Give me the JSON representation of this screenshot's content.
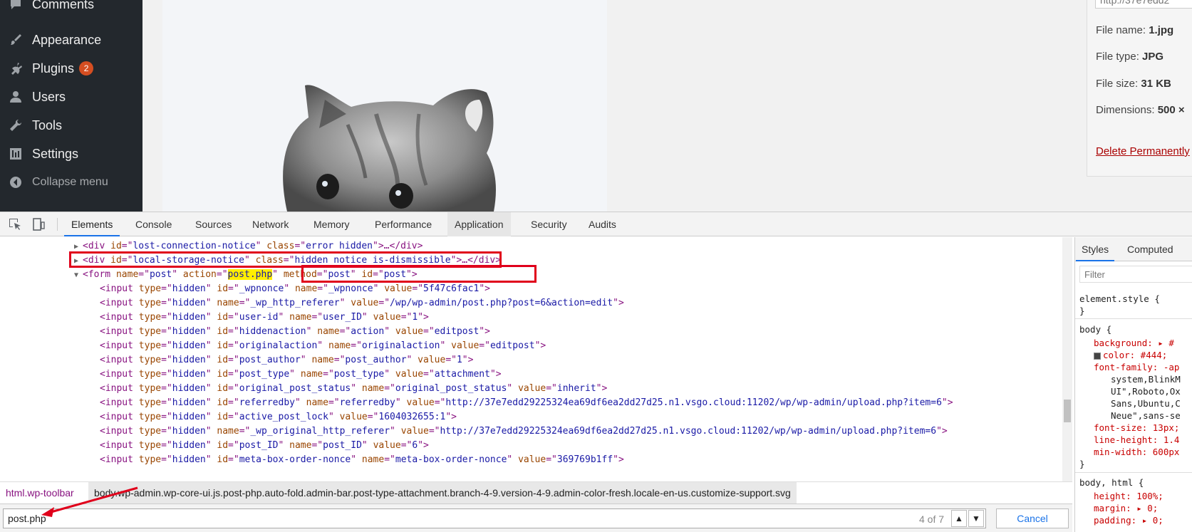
{
  "wp": {
    "menu": [
      {
        "label": "Comments",
        "icon": "comment-icon"
      },
      {
        "label": "Appearance",
        "icon": "paintbrush-icon"
      },
      {
        "label": "Plugins",
        "icon": "plugin-icon",
        "badge": "2"
      },
      {
        "label": "Users",
        "icon": "user-icon"
      },
      {
        "label": "Tools",
        "icon": "wrench-icon"
      },
      {
        "label": "Settings",
        "icon": "settings-icon"
      },
      {
        "label": "Collapse menu",
        "icon": "collapse-icon"
      }
    ],
    "attachment": {
      "url": "http://37e7edd2",
      "file_name_label": "File name:",
      "file_name": "1.jpg",
      "file_type_label": "File type:",
      "file_type": "JPG",
      "file_size_label": "File size:",
      "file_size": "31 KB",
      "dimensions_label": "Dimensions:",
      "dimensions": "500 ×",
      "delete_label": "Delete Permanently"
    }
  },
  "devtools": {
    "tabs": [
      "Elements",
      "Console",
      "Sources",
      "Network",
      "Memory",
      "Performance",
      "Application",
      "Security",
      "Audits"
    ],
    "active_tab": "Elements",
    "breadcrumb": {
      "first": "html.wp-toolbar",
      "selected": "body.wp-admin.wp-core-ui.js.post-php.auto-fold.admin-bar.post-type-attachment.branch-4-9.version-4-9.admin-color-fresh.locale-en-us.customize-support.svg"
    },
    "search": {
      "value": "post.php",
      "match_count": "4 of 7",
      "up": "▲",
      "down": "▼",
      "cancel": "Cancel"
    },
    "styles": {
      "tabs": [
        "Styles",
        "Computed"
      ],
      "filter_placeholder": "Filter",
      "lines": [
        "element.style {",
        "}",
        "body {",
        "background: ▸ #",
        "color: #444;",
        "font-family: -ap",
        "system,BlinkM",
        "UI\",Roboto,Ox",
        "Sans,Ubuntu,C",
        "Neue\",sans-se",
        "font-size: 13px;",
        "line-height: 1.4",
        "min-width: 600px",
        "}",
        "body, html {",
        "height: 100%;",
        "margin: ▸ 0;",
        "padding: ▸ 0;"
      ]
    },
    "code": [
      [
        "<div ",
        "id",
        "=\"",
        "lost-connection-notice",
        "\" ",
        "class",
        "=\"",
        "error hidden",
        "\">…</div>"
      ],
      [
        "<div ",
        "id",
        "=\"",
        "local-storage-notice",
        "\" ",
        "class",
        "=\"",
        "hidden notice is-dismissible",
        "\">…</div>"
      ],
      [
        "<form ",
        "name",
        "=\"",
        "post",
        "\" ",
        "action",
        "=\"",
        "post.php",
        "\" ",
        "method",
        "=\"",
        "post",
        "\" ",
        "id",
        "=\"",
        "post",
        "\">"
      ],
      [
        "<input ",
        "type",
        "=\"",
        "hidden",
        "\" ",
        "id",
        "=\"",
        "_wpnonce",
        "\" ",
        "name",
        "=\"",
        "_wpnonce",
        "\" ",
        "value",
        "=\"",
        "5f47c6fac1",
        "\">"
      ],
      [
        "<input ",
        "type",
        "=\"",
        "hidden",
        "\" ",
        "name",
        "=\"",
        "_wp_http_referer",
        "\" ",
        "value",
        "=\"",
        "/wp/wp-admin/post.php?post=6&action=edit",
        "\">"
      ],
      [
        "<input ",
        "type",
        "=\"",
        "hidden",
        "\" ",
        "id",
        "=\"",
        "user-id",
        "\" ",
        "name",
        "=\"",
        "user_ID",
        "\" ",
        "value",
        "=\"",
        "1",
        "\">"
      ],
      [
        "<input ",
        "type",
        "=\"",
        "hidden",
        "\" ",
        "id",
        "=\"",
        "hiddenaction",
        "\" ",
        "name",
        "=\"",
        "action",
        "\" ",
        "value",
        "=\"",
        "editpost",
        "\">"
      ],
      [
        "<input ",
        "type",
        "=\"",
        "hidden",
        "\" ",
        "id",
        "=\"",
        "originalaction",
        "\" ",
        "name",
        "=\"",
        "originalaction",
        "\" ",
        "value",
        "=\"",
        "editpost",
        "\">"
      ],
      [
        "<input ",
        "type",
        "=\"",
        "hidden",
        "\" ",
        "id",
        "=\"",
        "post_author",
        "\" ",
        "name",
        "=\"",
        "post_author",
        "\" ",
        "value",
        "=\"",
        "1",
        "\">"
      ],
      [
        "<input ",
        "type",
        "=\"",
        "hidden",
        "\" ",
        "id",
        "=\"",
        "post_type",
        "\" ",
        "name",
        "=\"",
        "post_type",
        "\" ",
        "value",
        "=\"",
        "attachment",
        "\">"
      ],
      [
        "<input ",
        "type",
        "=\"",
        "hidden",
        "\" ",
        "id",
        "=\"",
        "original_post_status",
        "\" ",
        "name",
        "=\"",
        "original_post_status",
        "\" ",
        "value",
        "=\"",
        "inherit",
        "\">"
      ],
      [
        "<input ",
        "type",
        "=\"",
        "hidden",
        "\" ",
        "id",
        "=\"",
        "referredby",
        "\" ",
        "name",
        "=\"",
        "referredby",
        "\" ",
        "value",
        "=\"",
        "http://37e7edd29225324ea69df6ea2dd27d25.n1.vsgo.cloud:11202/wp/wp-admin/upload.php?item=6",
        "\">"
      ],
      [
        "<input ",
        "type",
        "=\"",
        "hidden",
        "\" ",
        "id",
        "=\"",
        "active_post_lock",
        "\" ",
        "value",
        "=\"",
        "1604032655:1",
        "\">"
      ],
      [
        "<input ",
        "type",
        "=\"",
        "hidden",
        "\" ",
        "name",
        "=\"",
        "_wp_original_http_referer",
        "\" ",
        "value",
        "=\"",
        "http://37e7edd29225324ea69df6ea2dd27d25.n1.vsgo.cloud:11202/wp/wp-admin/upload.php?item=6",
        "\">"
      ],
      [
        "<input ",
        "type",
        "=\"",
        "hidden",
        "\" ",
        "id",
        "=\"",
        "post_ID",
        "\" ",
        "name",
        "=\"",
        "post_ID",
        "\" ",
        "value",
        "=\"",
        "6",
        "\">"
      ],
      [
        "<input ",
        "type",
        "=\"",
        "hidden",
        "\" ",
        "id",
        "=\"",
        "meta-box-order-nonce",
        "\" ",
        "name",
        "=\"",
        "meta-box-order-nonce",
        "\" ",
        "value",
        "=\"",
        "369769b1ff",
        "\">"
      ]
    ]
  },
  "colors": {
    "sidebar_bg": "#23282d",
    "annotation_red": "#e0001b",
    "search_highlight": "#ffee00",
    "tag": "#881280",
    "attr": "#994500",
    "value": "#1a1aa6"
  }
}
